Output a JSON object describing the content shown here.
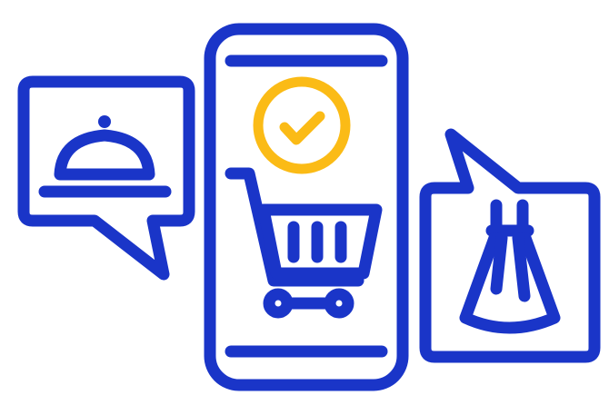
{
  "illustration": {
    "colors": {
      "primary": "#1a35c8",
      "accent": "#fbbb16",
      "background": "#ffffff"
    },
    "icons": {
      "phone": "smartphone-icon",
      "check": "checkmark-icon",
      "cart": "shopping-cart-icon",
      "food": "cloche-icon",
      "clothing": "dress-icon",
      "left_bubble": "speech-bubble-left-icon",
      "right_bubble": "speech-bubble-right-icon"
    }
  }
}
